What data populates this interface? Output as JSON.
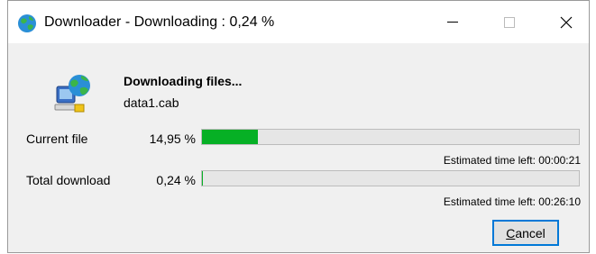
{
  "window": {
    "title": "Downloader - Downloading : 0,24 %",
    "app_icon": "globe-network-icon",
    "controls": {
      "minimize": "minimize-icon",
      "maximize": "maximize-icon",
      "close": "close-icon"
    }
  },
  "main": {
    "heading": "Downloading files...",
    "filename": "data1.cab",
    "big_icon": "network-computer-globe-icon"
  },
  "current_file": {
    "label": "Current file",
    "percent_text": "14,95 %",
    "progress": 0.1495,
    "eta": "Estimated time left: 00:00:21"
  },
  "total_download": {
    "label": "Total download",
    "percent_text": "0,24 %",
    "progress": 0.0024,
    "eta": "Estimated time left: 00:26:10"
  },
  "cancel_button": {
    "label_first": "C",
    "label_rest": "ancel"
  },
  "colors": {
    "progress_fill": "#06b025",
    "accent": "#0078d7"
  }
}
